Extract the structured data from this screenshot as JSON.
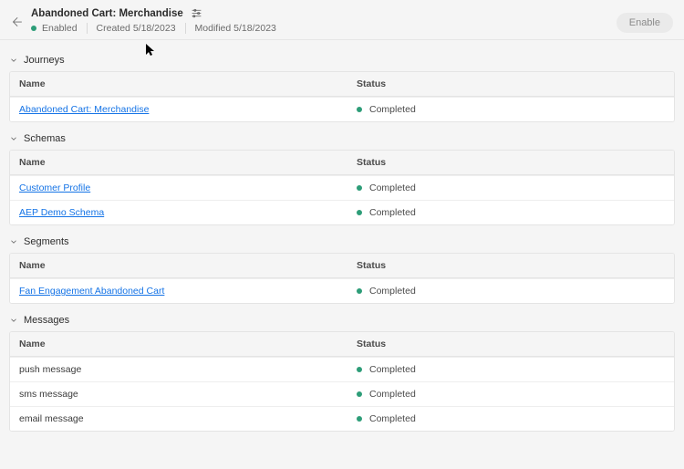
{
  "header": {
    "title": "Abandoned Cart: Merchandise",
    "enabled_label": "Enabled",
    "created_label": "Created",
    "created_date": "5/18/2023",
    "modified_label": "Modified",
    "modified_date": "5/18/2023",
    "enable_button": "Enable"
  },
  "columns": {
    "name": "Name",
    "status": "Status"
  },
  "status_completed": "Completed",
  "sections": {
    "journeys": {
      "title": "Journeys",
      "items": [
        {
          "name": "Abandoned Cart: Merchandise",
          "link": true,
          "status": "Completed"
        }
      ]
    },
    "schemas": {
      "title": "Schemas",
      "items": [
        {
          "name": "Customer Profile",
          "link": true,
          "status": "Completed"
        },
        {
          "name": "AEP Demo Schema",
          "link": true,
          "status": "Completed"
        }
      ]
    },
    "segments": {
      "title": "Segments",
      "items": [
        {
          "name": "Fan Engagement Abandoned Cart",
          "link": true,
          "status": "Completed"
        }
      ]
    },
    "messages": {
      "title": "Messages",
      "items": [
        {
          "name": "push message",
          "link": false,
          "status": "Completed"
        },
        {
          "name": "sms message",
          "link": false,
          "status": "Completed"
        },
        {
          "name": "email message",
          "link": false,
          "status": "Completed"
        }
      ]
    }
  }
}
